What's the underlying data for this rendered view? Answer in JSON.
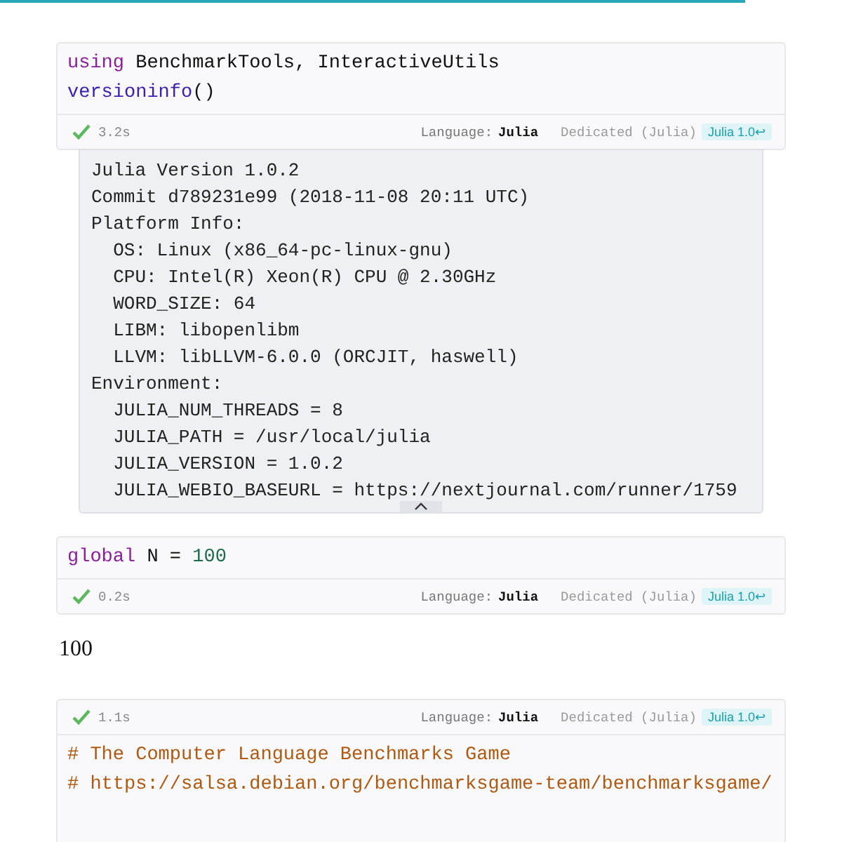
{
  "progress": {
    "level": 0.885
  },
  "cells": [
    {
      "kind": "code-first",
      "lines": [
        [
          {
            "kind": "keyword",
            "text": "using"
          },
          {
            "kind": "plain",
            "text": " BenchmarkTools, InteractiveUtils"
          }
        ],
        [
          {
            "kind": "function",
            "text": "versioninfo"
          },
          {
            "kind": "plain",
            "text": "()"
          }
        ]
      ],
      "footer": {
        "done": true,
        "time": "3.2s",
        "language_label": "Language:",
        "language": "Julia",
        "runtime": "Dedicated (Julia)",
        "env": "Julia 1.0↩"
      },
      "output": {
        "kind": "text",
        "lines": [
          "Julia Version 1.0.2",
          "Commit d789231e99 (2018-11-08 20:11 UTC)",
          "Platform Info:",
          "  OS: Linux (x86_64-pc-linux-gnu)",
          "  CPU: Intel(R) Xeon(R) CPU @ 2.30GHz",
          "  WORD_SIZE: 64",
          "  LIBM: libopenlibm",
          "  LLVM: libLLVM-6.0.0 (ORCJIT, haswell)",
          "Environment:",
          "  JULIA_NUM_THREADS = 8",
          "  JULIA_PATH = /usr/local/julia",
          "  JULIA_VERSION = 1.0.2",
          "  JULIA_WEBIO_BASEURL = https://nextjournal.com/runner/1759"
        ]
      }
    },
    {
      "kind": "code-first",
      "lines": [
        [
          {
            "kind": "keyword",
            "text": "global"
          },
          {
            "kind": "plain",
            "text": " N = "
          },
          {
            "kind": "number",
            "text": "100"
          }
        ]
      ],
      "footer": {
        "done": true,
        "time": "0.2s",
        "language_label": "Language:",
        "language": "Julia",
        "runtime": "Dedicated (Julia)",
        "env": "Julia 1.0↩"
      },
      "output": {
        "kind": "value",
        "text": "100"
      }
    },
    {
      "kind": "footer-first",
      "lines": [
        [
          {
            "kind": "comment",
            "text": "# The Computer Language Benchmarks Game"
          }
        ],
        [
          {
            "kind": "comment",
            "text": "# https://salsa.debian.org/benchmarksgame-team/benchmarksgame/"
          }
        ]
      ],
      "footer": {
        "done": true,
        "time": "1.1s",
        "language_label": "Language:",
        "language": "Julia",
        "runtime": "Dedicated (Julia)",
        "env": "Julia 1.0↩"
      }
    }
  ]
}
